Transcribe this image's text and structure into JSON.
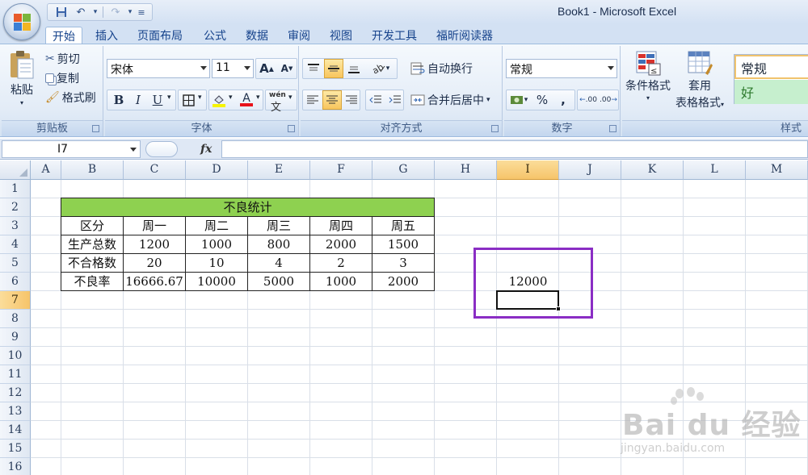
{
  "window": {
    "title": "Book1 - Microsoft Excel"
  },
  "quick_access": {
    "save_icon": "save-icon",
    "undo_icon": "undo-icon",
    "redo_icon": "redo-icon"
  },
  "tabs": [
    "开始",
    "插入",
    "页面布局",
    "公式",
    "数据",
    "审阅",
    "视图",
    "开发工具",
    "福昕阅读器"
  ],
  "active_tab": "开始",
  "ribbon": {
    "clipboard": {
      "label": "剪贴板",
      "paste": "粘贴",
      "cut": "剪切",
      "copy": "复制",
      "format_painter": "格式刷"
    },
    "font": {
      "label": "字体",
      "font_name": "宋体",
      "font_size": "11",
      "bold": "B",
      "italic": "I",
      "underline": "U",
      "font_color_letter": "A",
      "grow_font": "A",
      "shrink_font": "A",
      "phonetic": "wén"
    },
    "alignment": {
      "label": "对齐方式",
      "wrap_text": "自动换行",
      "merge_center": "合并后居中"
    },
    "number": {
      "label": "数字",
      "format": "常规",
      "percent": "%",
      "comma": ",",
      "inc_decimal": ".00",
      "dec_decimal": ".00"
    },
    "styles": {
      "label": "样式",
      "conditional_format": "条件格式",
      "table_format_1": "套用",
      "table_format_2": "表格格式",
      "style_normal": "常规",
      "style_good": "好"
    }
  },
  "formula_bar": {
    "name_box": "I7",
    "fx": "fx",
    "formula": ""
  },
  "columns": [
    "A",
    "B",
    "C",
    "D",
    "E",
    "F",
    "G",
    "H",
    "I",
    "J",
    "K",
    "L",
    "M"
  ],
  "rows": [
    "1",
    "2",
    "3",
    "4",
    "5",
    "6",
    "7",
    "8",
    "9",
    "10",
    "11",
    "12",
    "13",
    "14",
    "15",
    "16"
  ],
  "selected_column": "I",
  "selected_row": "7",
  "table": {
    "title": "不良统计",
    "header": [
      "区分",
      "周一",
      "周二",
      "周三",
      "周四",
      "周五"
    ],
    "rows": [
      [
        "生产总数",
        "1200",
        "1000",
        "800",
        "2000",
        "1500"
      ],
      [
        "不合格数",
        "20",
        "10",
        "4",
        "2",
        "3"
      ],
      [
        "不良率",
        "16666.67",
        "10000",
        "5000",
        "1000",
        "2000"
      ]
    ]
  },
  "cell_i6": "12000",
  "colors": {
    "table_header_fill": "#8ed150",
    "highlight_border": "#8a2dc4",
    "selected_header": "#f6c46a"
  },
  "watermark": {
    "brand": "Bai du 经验",
    "url": "jingyan.baidu.com"
  }
}
